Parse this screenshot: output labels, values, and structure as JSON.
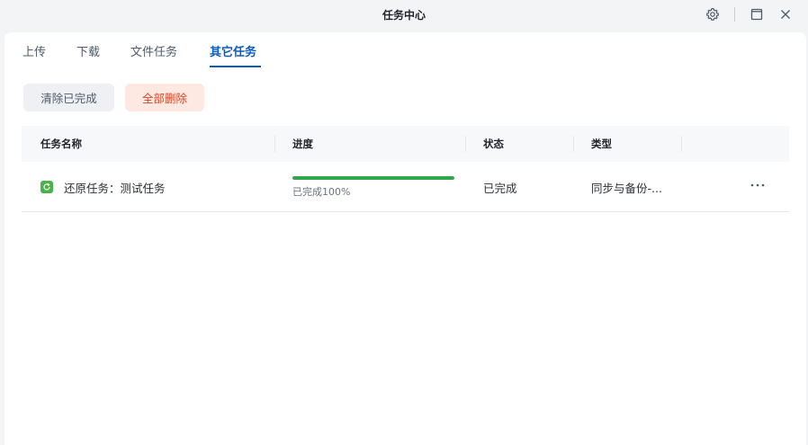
{
  "window": {
    "title": "任务中心",
    "controls": [
      "gear-icon",
      "maximize-icon",
      "close-icon"
    ]
  },
  "tabs": [
    {
      "label": "上传",
      "active": false
    },
    {
      "label": "下载",
      "active": false
    },
    {
      "label": "文件任务",
      "active": false
    },
    {
      "label": "其它任务",
      "active": true
    }
  ],
  "toolbar": {
    "clear_completed": "清除已完成",
    "delete_all": "全部删除"
  },
  "table": {
    "columns": [
      "任务名称",
      "进度",
      "状态",
      "类型"
    ],
    "rows": [
      {
        "name": "还原任务：测试任务",
        "progress_value": 100,
        "progress_label": "已完成100%",
        "status": "已完成",
        "type": "同步与备份-..."
      }
    ]
  },
  "colors": {
    "accent": "#0a5cc2",
    "danger": "#d5482a",
    "success": "#2ea84a"
  }
}
